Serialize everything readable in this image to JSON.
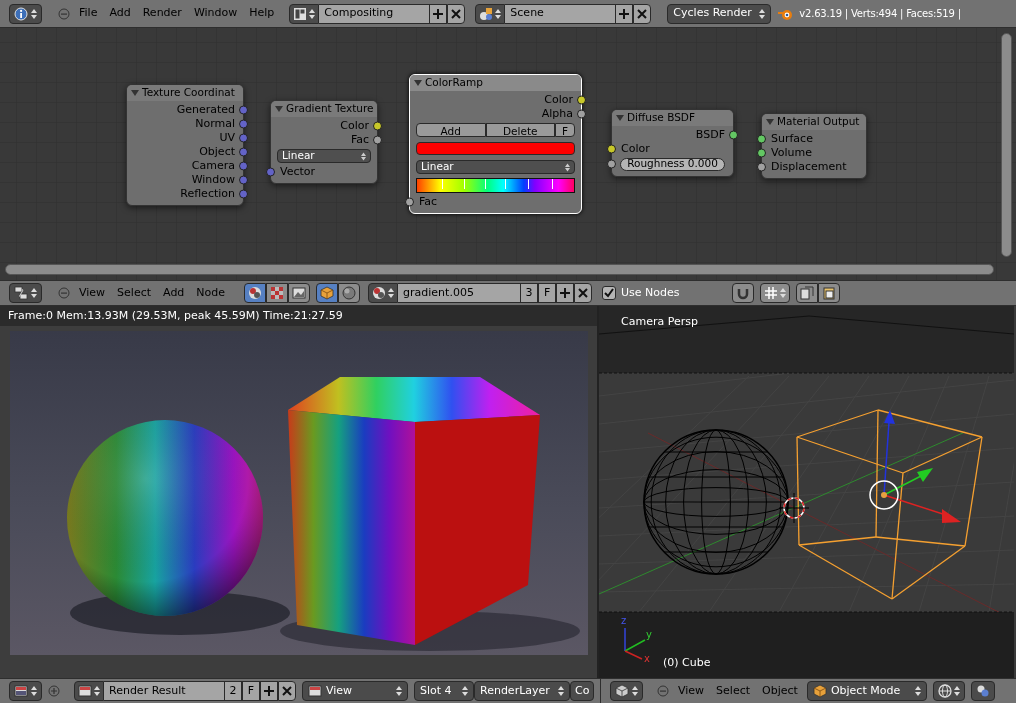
{
  "top_bar": {
    "menus": [
      "File",
      "Add",
      "Render",
      "Window",
      "Help"
    ],
    "screen_layout": "Compositing",
    "scene": "Scene",
    "render_engine": "Cycles Render",
    "stats": "v2.63.19 | Verts:494 | Faces:519 |"
  },
  "node_editor": {
    "nodes": [
      {
        "title": "Texture Coordinat",
        "selected": false,
        "rows": [
          {
            "kind": "output",
            "label": "Generated",
            "color": "#6363c7"
          },
          {
            "kind": "output",
            "label": "Normal",
            "color": "#6363c7"
          },
          {
            "kind": "output",
            "label": "UV",
            "color": "#6363c7"
          },
          {
            "kind": "output",
            "label": "Object",
            "color": "#6363c7"
          },
          {
            "kind": "output",
            "label": "Camera",
            "color": "#6363c7"
          },
          {
            "kind": "output",
            "label": "Window",
            "color": "#6363c7"
          },
          {
            "kind": "output",
            "label": "Reflection",
            "color": "#6363c7"
          }
        ]
      },
      {
        "title": "Gradient Texture",
        "selected": false,
        "rows": [
          {
            "kind": "output",
            "label": "Color",
            "color": "#c7c729"
          },
          {
            "kind": "output",
            "label": "Fac",
            "color": "#a1a1a1"
          },
          {
            "kind": "dropdown",
            "value": "Linear"
          },
          {
            "kind": "input",
            "label": "Vector",
            "color": "#6363c7"
          }
        ]
      },
      {
        "title": "ColorRamp",
        "selected": true,
        "rows": [
          {
            "kind": "output",
            "label": "Color",
            "color": "#c7c729"
          },
          {
            "kind": "output",
            "label": "Alpha",
            "color": "#a1a1a1"
          },
          {
            "kind": "buttons",
            "labels": [
              "Add",
              "Delete",
              "F"
            ]
          },
          {
            "kind": "swatch",
            "color": "#ff0000"
          },
          {
            "kind": "dropdown",
            "value": "Linear"
          },
          {
            "kind": "ramp"
          },
          {
            "kind": "input",
            "label": "Fac",
            "color": "#a1a1a1"
          }
        ]
      },
      {
        "title": "Diffuse BSDF",
        "selected": false,
        "rows": [
          {
            "kind": "output",
            "label": "BSDF",
            "color": "#63c763"
          },
          {
            "kind": "input",
            "label": "Color",
            "color": "#c7c729"
          },
          {
            "kind": "field",
            "label": "Roughness 0.000",
            "color": "#a1a1a1"
          }
        ]
      },
      {
        "title": "Material Output",
        "selected": false,
        "rows": [
          {
            "kind": "input",
            "label": "Surface",
            "color": "#63c763"
          },
          {
            "kind": "input",
            "label": "Volume",
            "color": "#63c763"
          },
          {
            "kind": "input",
            "label": "Displacement",
            "color": "#a1a1a1"
          }
        ]
      }
    ]
  },
  "node_header": {
    "menus": [
      "View",
      "Select",
      "Add",
      "Node"
    ],
    "tree_types": [
      {
        "kind": "shader",
        "selected": true
      },
      {
        "kind": "compositing",
        "selected": false
      },
      {
        "kind": "texture",
        "selected": false
      }
    ],
    "shader_sources": [
      {
        "kind": "object",
        "selected": true
      },
      {
        "kind": "world",
        "selected": false
      }
    ],
    "material": "gradient.005",
    "users": "3",
    "fake_user": "F",
    "use_nodes": {
      "label": "Use Nodes",
      "checked": true
    }
  },
  "image_editor": {
    "info": "Frame:0 Mem:13.93M (29.53M, peak 45.59M) Time:21:27.59"
  },
  "viewport": {
    "view_name": "Camera Persp",
    "object_label": "(0) Cube",
    "axes": [
      "z",
      "y",
      "x"
    ]
  },
  "image_header": {
    "image": "Render Result",
    "users": "2",
    "fake_user": "F",
    "view_menu": "View",
    "slot": "Slot 4",
    "layer": "RenderLayer",
    "pass": "Co"
  },
  "view3d_header": {
    "menus": [
      "View",
      "Select",
      "Object"
    ],
    "mode": "Object Mode"
  }
}
